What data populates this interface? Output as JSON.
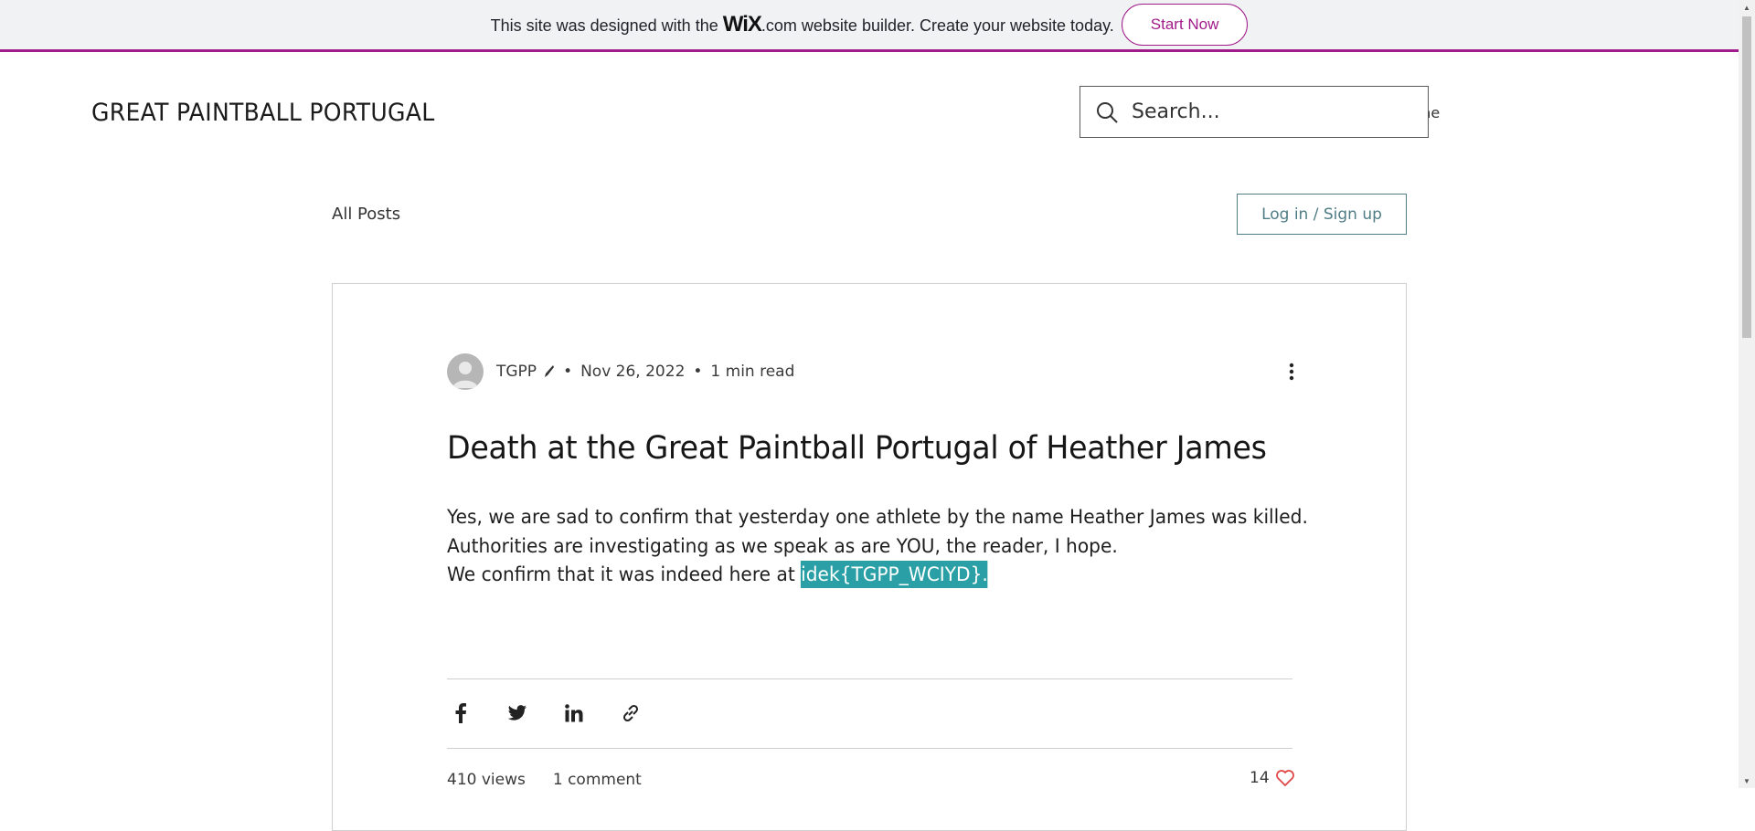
{
  "banner": {
    "text_before": "This site was designed with the",
    "logo": "WiX",
    "dotcom": ".com",
    "text_after": "website builder. Create your website today.",
    "button_label": "Start Now",
    "accent_color": "#a01a8a"
  },
  "header": {
    "site_title": "GREAT PAINTBALL PORTUGAL",
    "nav_partial": "ome",
    "search_placeholder": "Search..."
  },
  "blog_nav": {
    "all_posts": "All Posts",
    "login": "Log in / Sign up"
  },
  "post": {
    "author": "TGPP",
    "date": "Nov 26, 2022",
    "read_time": "1 min read",
    "title": "Death at the Great Paintball Portugal of Heather James",
    "line1": "Yes, we are sad to confirm that yesterday one athlete by the name Heather James was killed.",
    "line2": "Authorities are investigating as we speak as are YOU, the reader, I hope.",
    "line3_prefix": "We confirm that it was indeed here at ",
    "line3_highlight": "idek{TGPP_WCIYD}.",
    "views": "410 views",
    "comments": "1 comment",
    "likes": "14",
    "highlight_color": "#2aa0a6"
  },
  "share_icons": [
    "facebook-icon",
    "twitter-icon",
    "linkedin-icon",
    "link-icon"
  ]
}
